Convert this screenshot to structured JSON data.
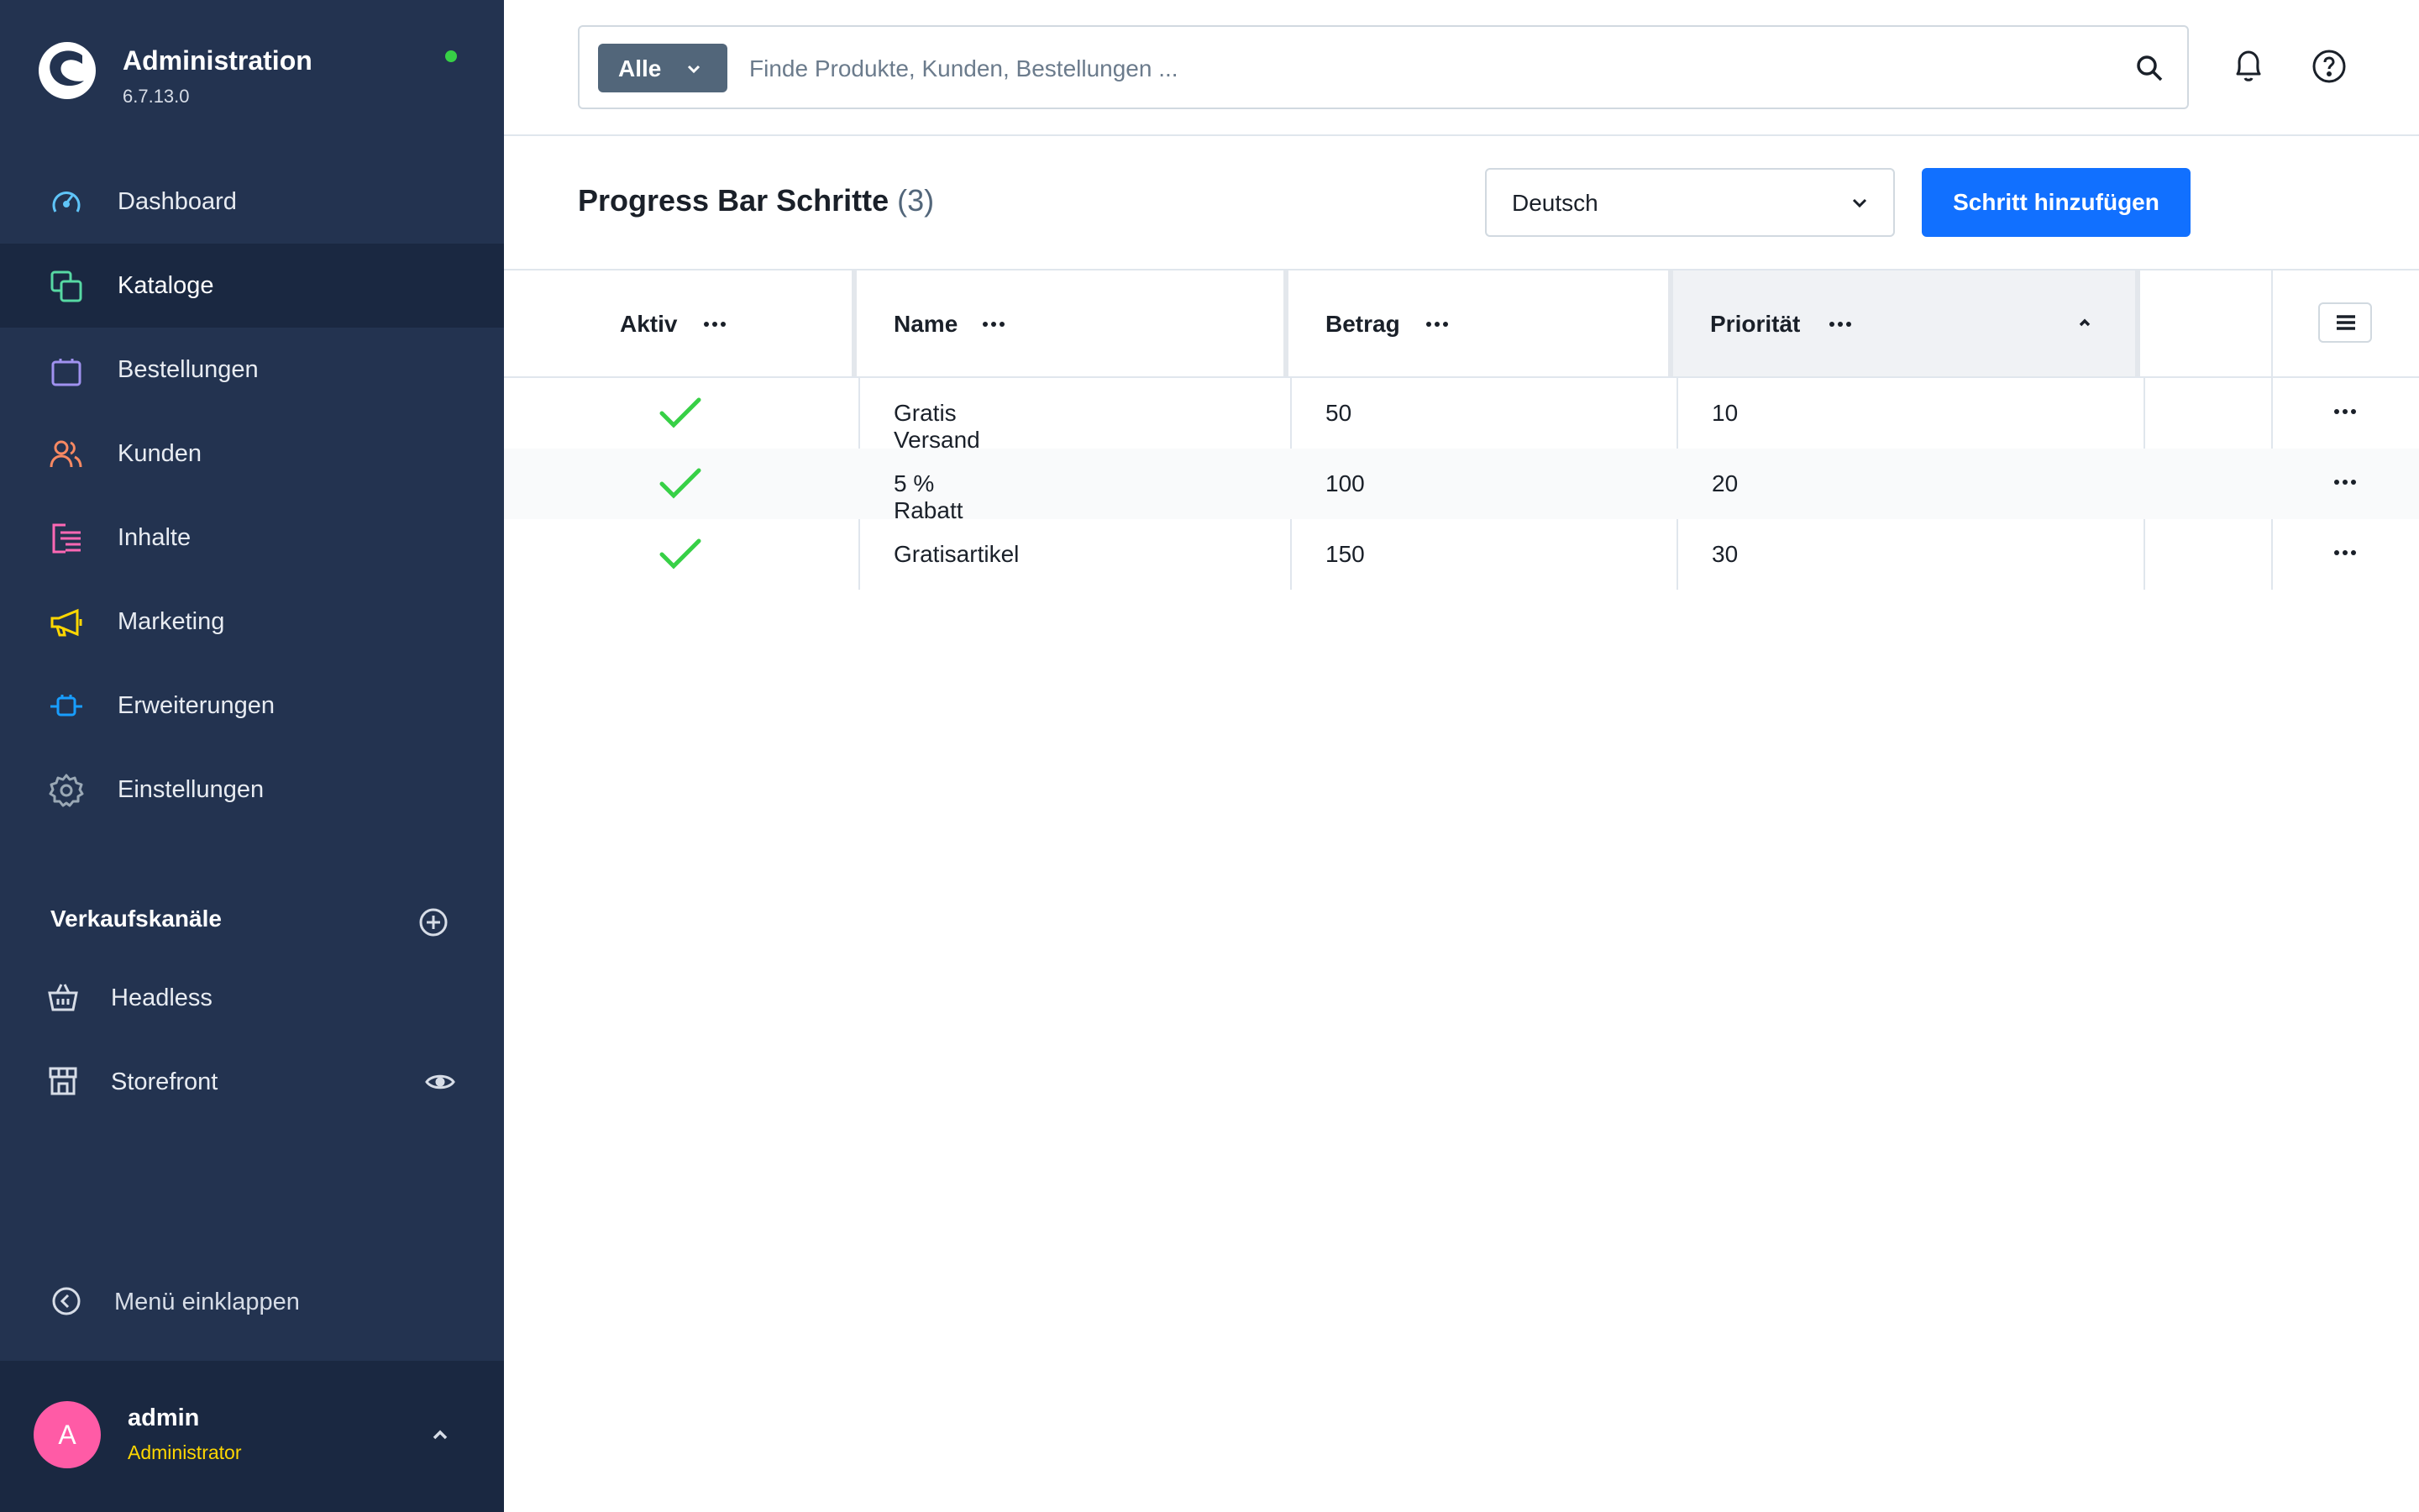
{
  "app": {
    "title": "Administration",
    "version": "6.7.13.0"
  },
  "nav": {
    "items": [
      {
        "label": "Dashboard",
        "icon": "gauge-icon",
        "color": "#5fc4f8",
        "active": false
      },
      {
        "label": "Kataloge",
        "icon": "catalog-icon",
        "color": "#57d9a3",
        "active": true
      },
      {
        "label": "Bestellungen",
        "icon": "shopping-bag-icon",
        "color": "#a092f0",
        "active": false
      },
      {
        "label": "Kunden",
        "icon": "users-icon",
        "color": "#f88962",
        "active": false
      },
      {
        "label": "Inhalte",
        "icon": "content-icon",
        "color": "#ff68b4",
        "active": false
      },
      {
        "label": "Marketing",
        "icon": "megaphone-icon",
        "color": "#ffd700",
        "active": false
      },
      {
        "label": "Erweiterungen",
        "icon": "plugin-icon",
        "color": "#189eff",
        "active": false
      },
      {
        "label": "Einstellungen",
        "icon": "gear-icon",
        "color": "#9aa8b5",
        "active": false
      }
    ]
  },
  "sales_channels": {
    "title": "Verkaufskanäle",
    "items": [
      {
        "label": "Headless",
        "icon": "basket-icon"
      },
      {
        "label": "Storefront",
        "icon": "storefront-icon"
      }
    ]
  },
  "collapse_label": "Menü einklappen",
  "user": {
    "initial": "A",
    "name": "admin",
    "role": "Administrator"
  },
  "search": {
    "type_label": "Alle",
    "placeholder": "Finde Produkte, Kunden, Bestellungen ..."
  },
  "page": {
    "title": "Progress Bar Schritte",
    "count": "(3)"
  },
  "language_select": {
    "value": "Deutsch"
  },
  "add_button": "Schritt hinzufügen",
  "table": {
    "columns": [
      "Aktiv",
      "Name",
      "Betrag",
      "Priorität"
    ],
    "sorted_column": "Priorität",
    "sort_direction": "asc",
    "rows": [
      {
        "active": true,
        "name": "Gratis Versand",
        "amount": "50",
        "priority": "10"
      },
      {
        "active": true,
        "name": "5 % Rabatt",
        "amount": "100",
        "priority": "20"
      },
      {
        "active": true,
        "name": "Gratisartikel",
        "amount": "150",
        "priority": "30"
      }
    ]
  },
  "colors": {
    "sidebar": "#233350",
    "sidebar_active": "#1a2841",
    "primary": "#1170ff",
    "check": "#37d046",
    "status_online": "#37d046",
    "avatar": "#ff5ba6",
    "role": "#ffd700"
  }
}
